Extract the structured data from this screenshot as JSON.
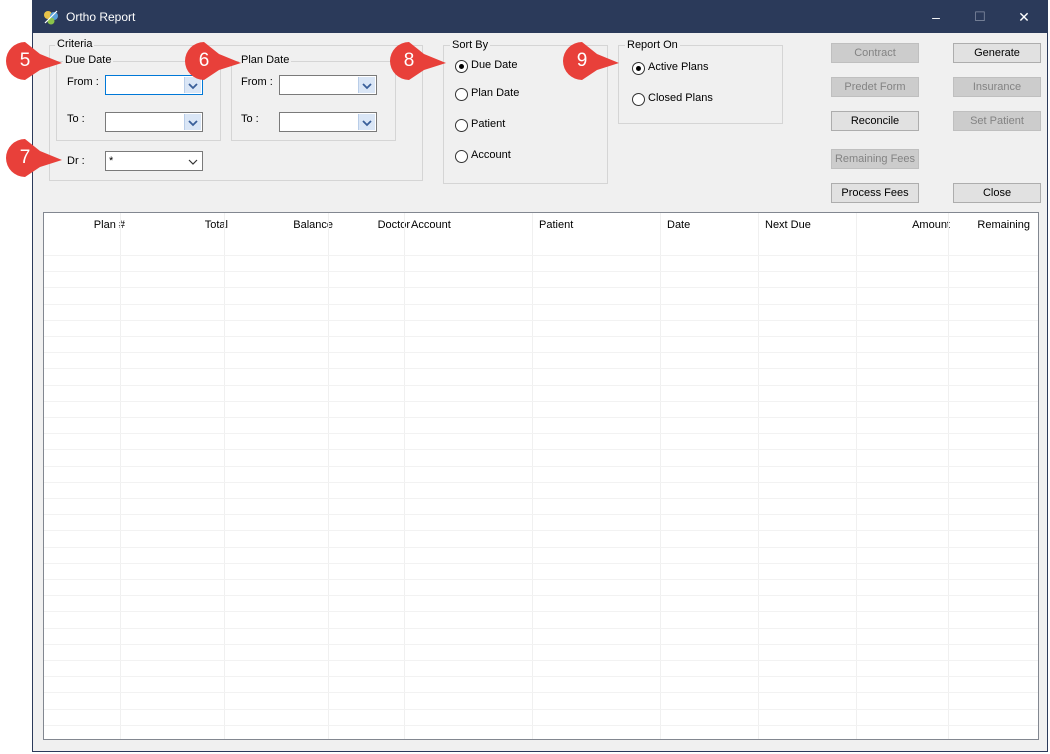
{
  "window": {
    "title": "Ortho Report",
    "minimize_glyph": "–",
    "maximize_glyph": "☐",
    "close_glyph": "✕"
  },
  "criteria": {
    "legend": "Criteria",
    "due_date": {
      "legend": "Due Date",
      "from_label": "From :",
      "to_label": "To :",
      "from_value": "",
      "to_value": ""
    },
    "plan_date": {
      "legend": "Plan Date",
      "from_label": "From :",
      "to_label": "To :",
      "from_value": "",
      "to_value": ""
    },
    "dr_label": "Dr :",
    "dr_value": "*"
  },
  "sort_by": {
    "legend": "Sort By",
    "options": [
      "Due Date",
      "Plan Date",
      "Patient",
      "Account"
    ],
    "selected": "Due Date"
  },
  "report_on": {
    "legend": "Report On",
    "options": [
      "Active Plans",
      "Closed Plans"
    ],
    "selected": "Active Plans"
  },
  "buttons": {
    "contract": {
      "label": "Contract",
      "enabled": false
    },
    "generate": {
      "label": "Generate",
      "enabled": true
    },
    "predet_form": {
      "label": "Predet Form",
      "enabled": false
    },
    "insurance": {
      "label": "Insurance",
      "enabled": false
    },
    "reconcile": {
      "label": "Reconcile",
      "enabled": true
    },
    "set_patient": {
      "label": "Set Patient",
      "enabled": false
    },
    "remaining_fees": {
      "label": "Remaining Fees",
      "enabled": false
    },
    "process_fees": {
      "label": "Process Fees",
      "enabled": true
    },
    "close": {
      "label": "Close",
      "enabled": true
    }
  },
  "grid": {
    "columns": [
      "Plan #",
      "Total",
      "Balance",
      "Doctor",
      "Account",
      "Patient",
      "Date",
      "Next Due",
      "Amount",
      "Remaining"
    ],
    "rows": []
  },
  "callouts": [
    "5",
    "6",
    "7",
    "8",
    "9"
  ],
  "colors": {
    "titlebar": "#2b3a5a",
    "callout": "#e8403a",
    "focus": "#0078d7"
  }
}
